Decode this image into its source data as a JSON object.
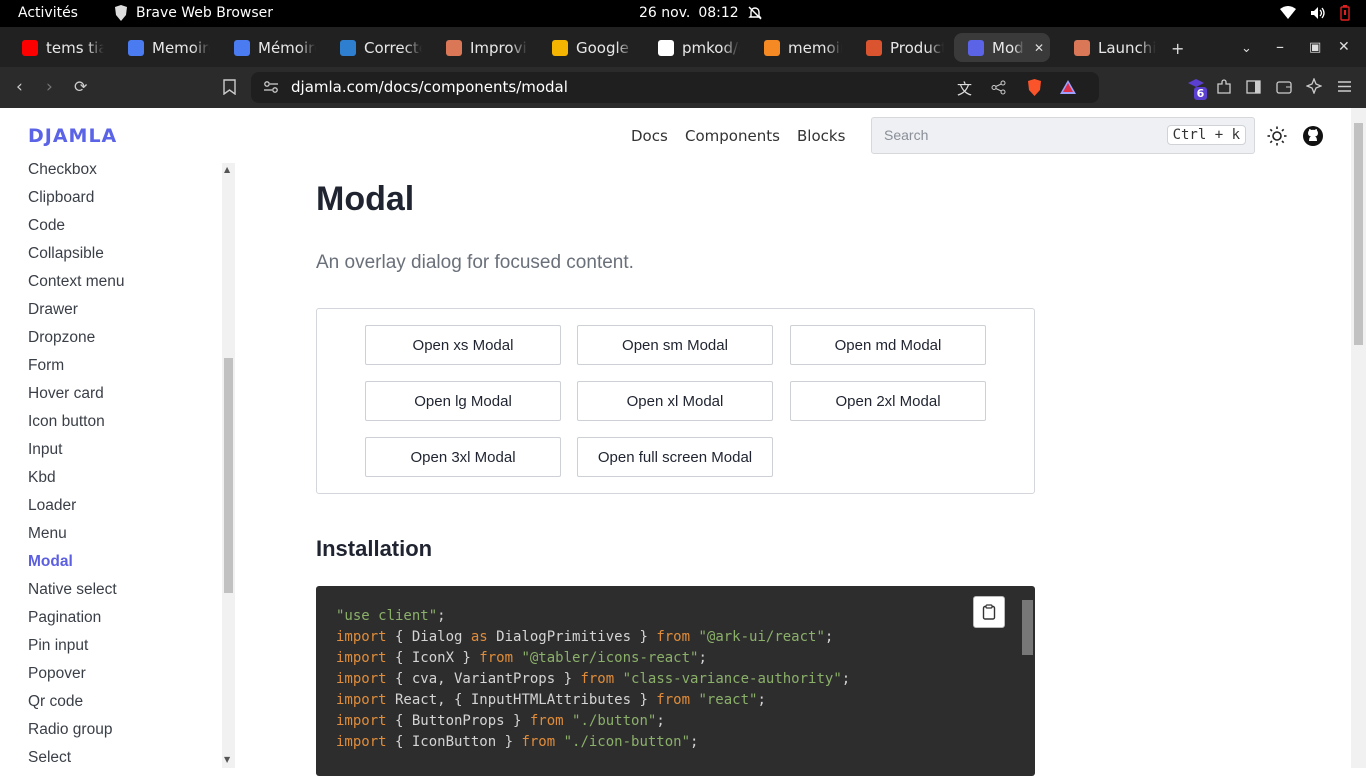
{
  "system": {
    "activities": "Activités",
    "app_name": "Brave Web Browser",
    "date": "26 nov.",
    "time": "08:12"
  },
  "tabs": [
    {
      "title": "tems tia",
      "favicon": "youtube-icon",
      "color": "#ff0000"
    },
    {
      "title": "Memoire",
      "favicon": "docs-icon",
      "color": "#4a7bf0"
    },
    {
      "title": "Mémoire",
      "favicon": "docs-icon",
      "color": "#4a7bf0"
    },
    {
      "title": "Correcte",
      "favicon": "corrector-icon",
      "color": "#2f7fd0"
    },
    {
      "title": "Improvin",
      "favicon": "claude-icon",
      "color": "#d97757"
    },
    {
      "title": "Google K",
      "favicon": "keep-icon",
      "color": "#f5b400"
    },
    {
      "title": "pmkod/d",
      "favicon": "github-icon",
      "color": "#ffffff"
    },
    {
      "title": "memoire",
      "favicon": "gitlab-icon",
      "color": "#f58a25"
    },
    {
      "title": "Product",
      "favicon": "producthunt-icon",
      "color": "#da552f"
    },
    {
      "title": "Mod",
      "favicon": "djamla-icon",
      "color": "#5b63e6"
    },
    {
      "title": "Launchi",
      "favicon": "claude-icon",
      "color": "#d97757"
    }
  ],
  "address_bar": {
    "url": "djamla.com/docs/components/modal"
  },
  "extensions": {
    "badge_count": "6"
  },
  "site": {
    "logo": "DJAMLA",
    "nav": [
      "Docs",
      "Components",
      "Blocks"
    ],
    "search_placeholder": "Search",
    "search_shortcut": "Ctrl + k"
  },
  "sidebar": {
    "items": [
      "Checkbox",
      "Clipboard",
      "Code",
      "Collapsible",
      "Context menu",
      "Drawer",
      "Dropzone",
      "Form",
      "Hover card",
      "Icon button",
      "Input",
      "Kbd",
      "Loader",
      "Menu",
      "Modal",
      "Native select",
      "Pagination",
      "Pin input",
      "Popover",
      "Qr code",
      "Radio group",
      "Select"
    ],
    "active": "Modal"
  },
  "page": {
    "title": "Modal",
    "lead": "An overlay dialog for focused content.",
    "buttons": [
      "Open xs Modal",
      "Open sm Modal",
      "Open md Modal",
      "Open lg Modal",
      "Open xl Modal",
      "Open 2xl Modal",
      "Open 3xl Modal",
      "Open full screen Modal"
    ],
    "installation_heading": "Installation",
    "code": [
      "\"use client\";",
      "import { Dialog as DialogPrimitives } from \"@ark-ui/react\";",
      "import { IconX } from \"@tabler/icons-react\";",
      "import { cva, VariantProps } from \"class-variance-authority\";",
      "import React, { InputHTMLAttributes } from \"react\";",
      "import { ButtonProps } from \"./button\";",
      "import { IconButton } from \"./icon-button\";"
    ]
  },
  "colors": {
    "accent": "#5b5fe0",
    "code_bg": "#2d2d2d",
    "keyword": "#e08c3a",
    "string": "#8bb06a"
  }
}
